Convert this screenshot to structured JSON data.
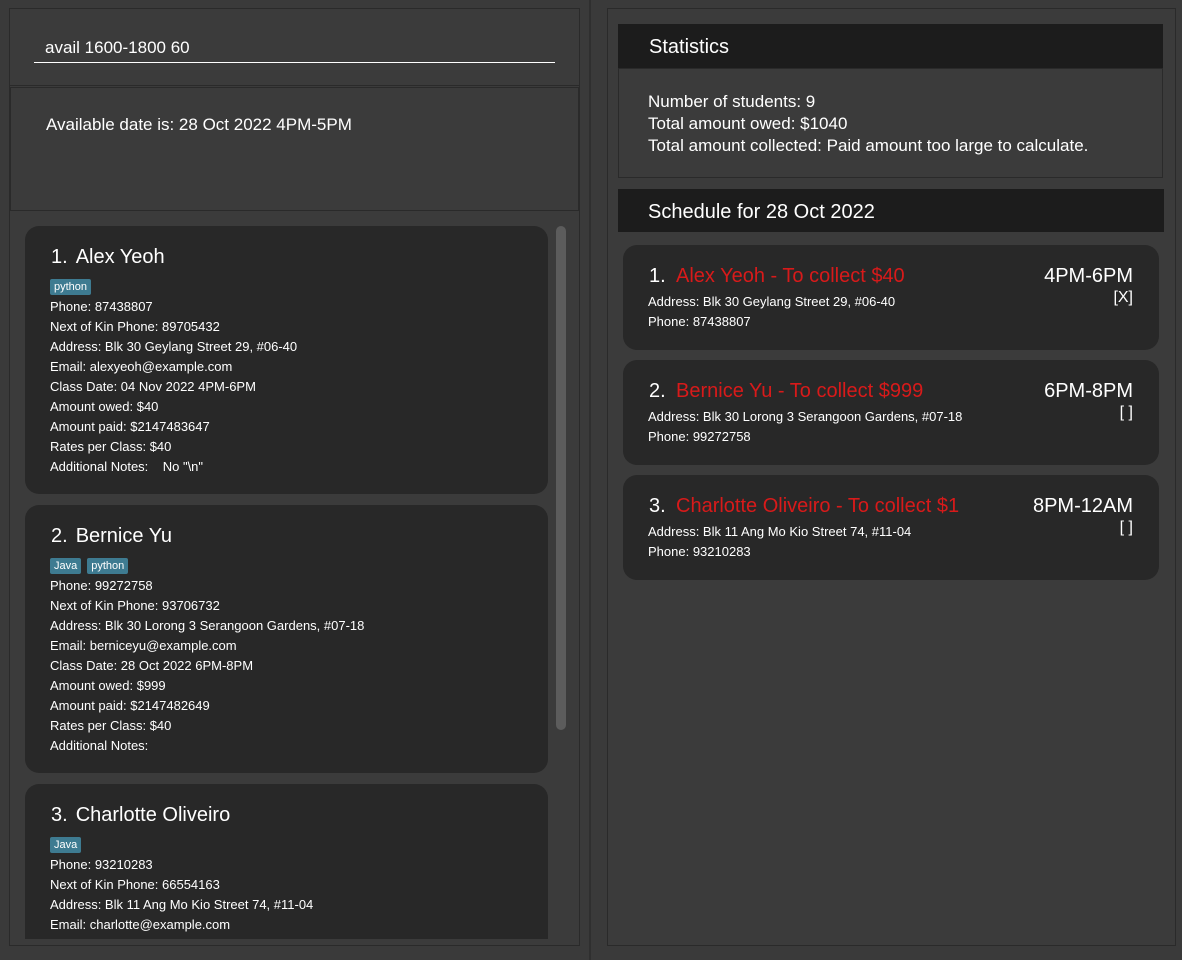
{
  "command": {
    "value": "avail 1600-1800 60"
  },
  "result": {
    "text": "Available date is: 28 Oct 2022 4PM-5PM"
  },
  "persons": [
    {
      "index": "1.",
      "name": "Alex Yeoh",
      "tags": [
        "python"
      ],
      "phone": "Phone: 87438807",
      "nok_phone": "Next of Kin Phone: 89705432",
      "address": "Address: Blk 30 Geylang Street 29, #06-40",
      "email": "Email: alexyeoh@example.com",
      "class_date": "Class Date: 04 Nov 2022 4PM-6PM",
      "amount_owed": "Amount owed: $40",
      "amount_paid": "Amount paid: $2147483647",
      "rates": "Rates per Class: $40",
      "notes": "Additional Notes:    No \"\\n\""
    },
    {
      "index": "2.",
      "name": "Bernice Yu",
      "tags": [
        "Java",
        "python"
      ],
      "phone": "Phone: 99272758",
      "nok_phone": "Next of Kin Phone: 93706732",
      "address": "Address: Blk 30 Lorong 3 Serangoon Gardens, #07-18",
      "email": "Email: berniceyu@example.com",
      "class_date": "Class Date: 28 Oct 2022 6PM-8PM",
      "amount_owed": "Amount owed: $999",
      "amount_paid": "Amount paid: $2147482649",
      "rates": "Rates per Class: $40",
      "notes": "Additional Notes:"
    },
    {
      "index": "3.",
      "name": "Charlotte Oliveiro",
      "tags": [
        "Java"
      ],
      "phone": "Phone: 93210283",
      "nok_phone": "Next of Kin Phone: 66554163",
      "address": "Address: Blk 11 Ang Mo Kio Street 74, #11-04",
      "email": "Email: charlotte@example.com"
    }
  ],
  "statistics": {
    "title": "Statistics",
    "students": "Number of students: 9",
    "owed": "Total amount owed: $1040",
    "collected": "Total amount collected: Paid amount too large to calculate."
  },
  "schedule": {
    "title": "Schedule for 28 Oct 2022",
    "items": [
      {
        "index": "1.",
        "title": "Alex Yeoh - To collect $40",
        "time": "4PM-6PM",
        "check": "[X]",
        "address": "Address: Blk 30 Geylang Street 29, #06-40",
        "phone": "Phone: 87438807"
      },
      {
        "index": "2.",
        "title": "Bernice Yu - To collect $999",
        "time": "6PM-8PM",
        "check": "[ ]",
        "address": "Address: Blk 30 Lorong 3 Serangoon Gardens, #07-18",
        "phone": "Phone: 99272758"
      },
      {
        "index": "3.",
        "title": "Charlotte Oliveiro - To collect $1",
        "time": "8PM-12AM",
        "check": "[ ]",
        "address": "Address: Blk 11 Ang Mo Kio Street 74, #11-04",
        "phone": "Phone: 93210283"
      }
    ]
  },
  "colors": {
    "background": "#3b3b3b",
    "card": "#282828",
    "header": "#1c1c1c",
    "tag": "#3e7b91",
    "schedule_name": "#d81a1a"
  }
}
